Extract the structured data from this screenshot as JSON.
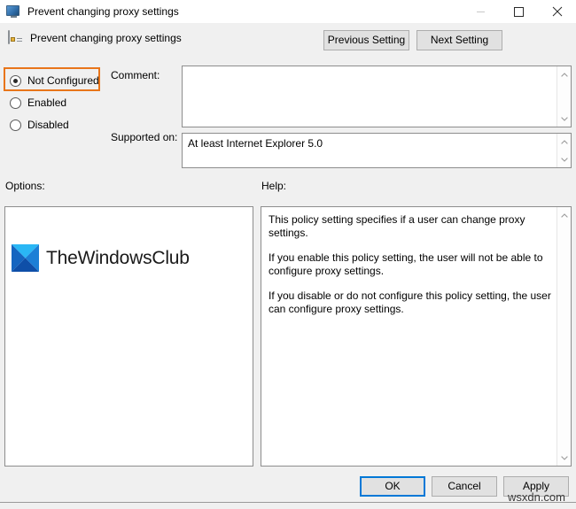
{
  "window": {
    "title": "Prevent changing proxy settings",
    "icon": "monitor-icon",
    "controls": {
      "minimize": "minimize-icon",
      "maximize": "maximize-icon",
      "close": "close-icon"
    }
  },
  "header": {
    "icon": "policy-setting-icon",
    "title": "Prevent changing proxy settings",
    "previous_label": "Previous Setting",
    "next_label": "Next Setting"
  },
  "state": {
    "options": [
      {
        "label": "Not Configured",
        "selected": true
      },
      {
        "label": "Enabled",
        "selected": false
      },
      {
        "label": "Disabled",
        "selected": false
      }
    ],
    "highlight_color": "#e8751a"
  },
  "comment": {
    "label": "Comment:",
    "value": "",
    "placeholder": ""
  },
  "supported": {
    "label": "Supported on:",
    "value": "At least Internet Explorer 5.0"
  },
  "options_panel": {
    "label": "Options:",
    "watermark_text": "TheWindowsClub",
    "watermark_colors": {
      "top": "#29b6f6",
      "left": "#1565c0",
      "right": "#0d8fd9",
      "bottom": "#1565c0"
    }
  },
  "help_panel": {
    "label": "Help:",
    "paragraphs": [
      "This policy setting specifies if a user can change proxy settings.",
      "If you enable this policy setting, the user will not be able to configure proxy settings.",
      "If you disable or do not configure this policy setting, the user can configure proxy settings."
    ]
  },
  "footer": {
    "ok_label": "OK",
    "cancel_label": "Cancel",
    "apply_label": "Apply",
    "focus_color": "#0078d7"
  },
  "watermarks": {
    "site": "wsxdn.com"
  }
}
